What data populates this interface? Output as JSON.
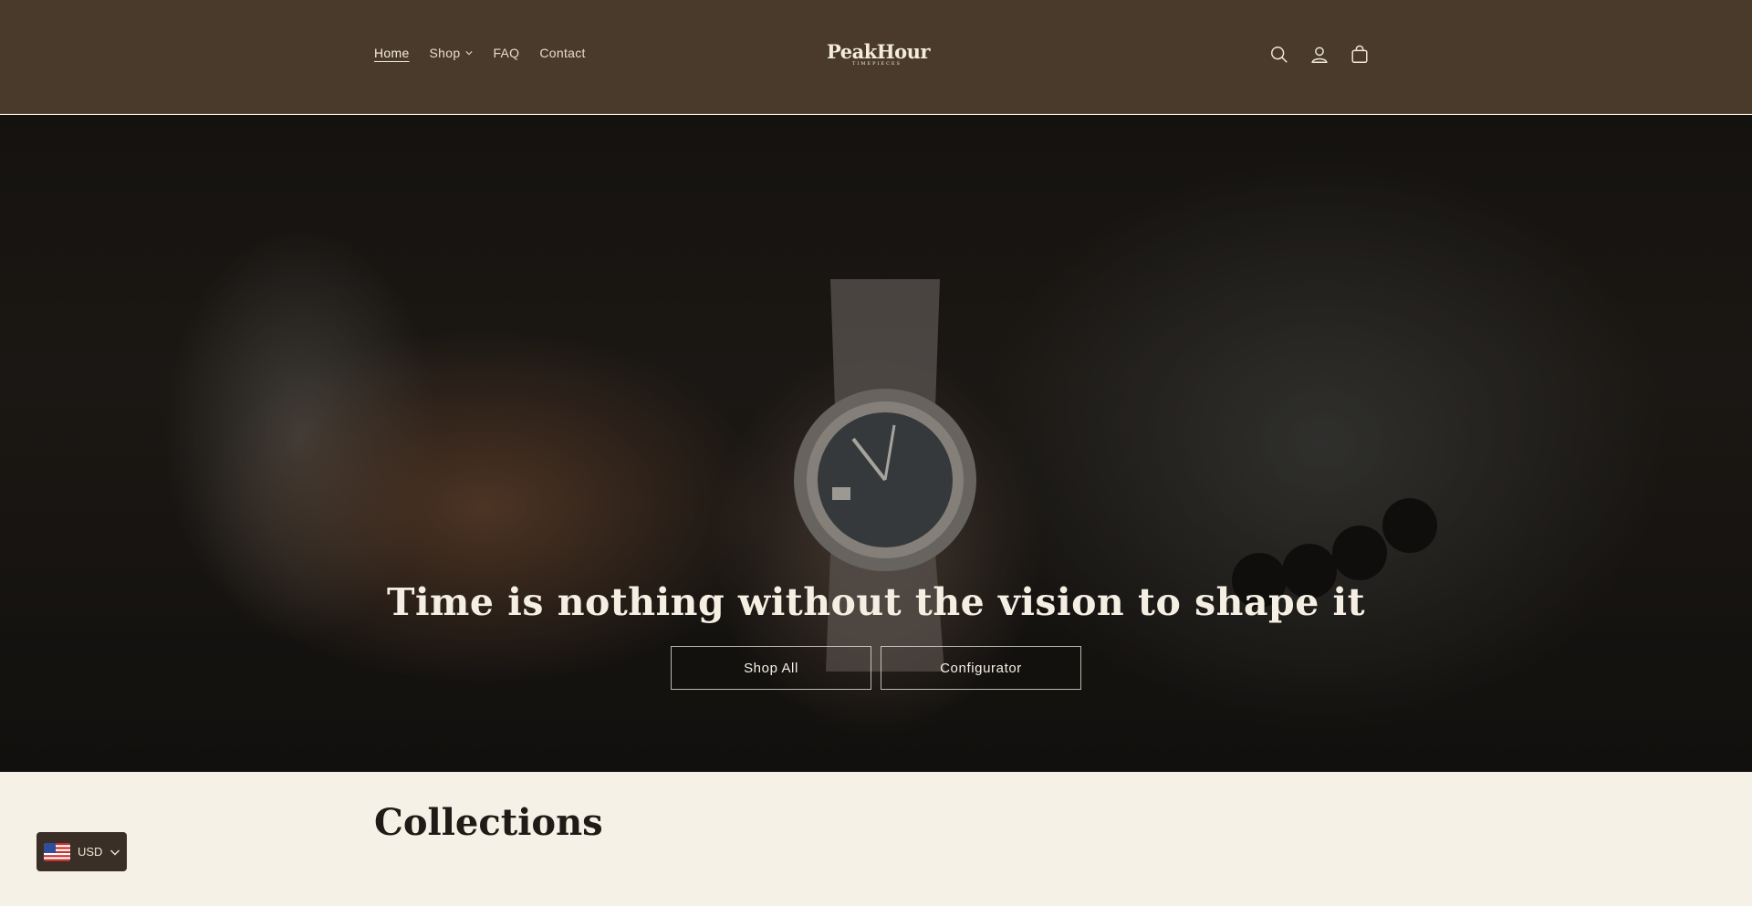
{
  "header": {
    "nav": [
      {
        "label": "Home",
        "active": true
      },
      {
        "label": "Shop",
        "has_dropdown": true
      },
      {
        "label": "FAQ"
      },
      {
        "label": "Contact"
      }
    ],
    "logo": {
      "main": "PeakHour",
      "sub": "TIMEPIECES"
    },
    "icons": [
      "search-icon",
      "account-icon",
      "cart-icon"
    ]
  },
  "hero": {
    "title": "Time is nothing without the vision to shape it",
    "buttons": [
      {
        "label": "Shop All"
      },
      {
        "label": "Configurator"
      }
    ]
  },
  "collections": {
    "title": "Collections"
  },
  "currency": {
    "code": "USD"
  },
  "colors": {
    "header_bg": "#4a3a2c",
    "page_bg": "#f6f1e6",
    "currency_bg": "#3a2f26"
  }
}
